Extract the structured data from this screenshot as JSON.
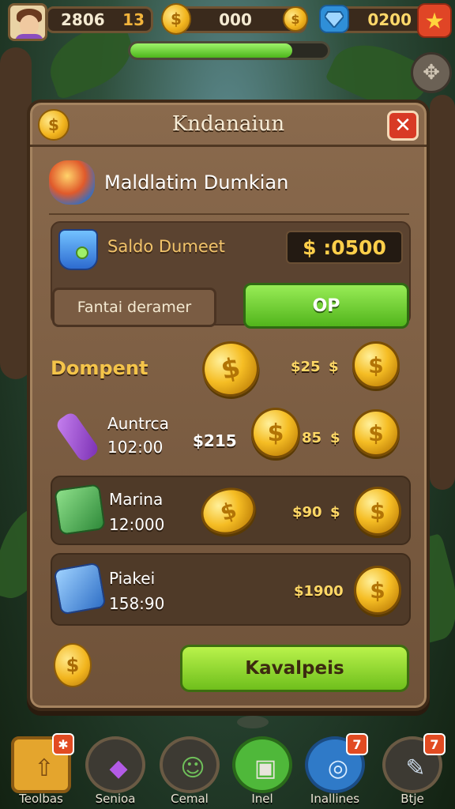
{
  "hud": {
    "player_score": "2806",
    "player_level": "13",
    "coins": "000",
    "coin_symbol": "$",
    "gems": "0200",
    "xp_fill_percent": 82
  },
  "dialog": {
    "title": "Kndanaiun",
    "subtitle": "Maldlatim Dumkian",
    "close_label": "✕",
    "balance_label": "Saldo Dumeet",
    "balance_value": "$ :0500",
    "field_label": "Fantai deramer",
    "ok_label": "OP",
    "section_label": "Dompent",
    "main_button_label": "Kavalpeis"
  },
  "rewards": [
    {
      "name": "",
      "time": "",
      "amount": "",
      "price": "$25"
    },
    {
      "name": "Auntrca",
      "time": "102:00",
      "amount": "$215",
      "price": "85"
    },
    {
      "name": "Marina",
      "time": "12:000",
      "amount": "",
      "price": "$90"
    },
    {
      "name": "Piakei",
      "time": "158:90",
      "amount": "",
      "price": "$1900"
    }
  ],
  "nav": [
    {
      "label": "Teolbas",
      "badge": "✱"
    },
    {
      "label": "Senioa",
      "badge": ""
    },
    {
      "label": "Cemal",
      "badge": ""
    },
    {
      "label": "Inel",
      "badge": ""
    },
    {
      "label": "Inallines",
      "badge": "7"
    },
    {
      "label": "Btje",
      "badge": "7"
    }
  ],
  "colors": {
    "panel": "#7a5c43",
    "accent_green": "#6fbf1c",
    "gold": "#f5bd24",
    "close_red": "#d83a25"
  },
  "icons": {
    "top_settings": "compass-icon",
    "gem": "blue-gem-icon",
    "star": "star-icon"
  }
}
